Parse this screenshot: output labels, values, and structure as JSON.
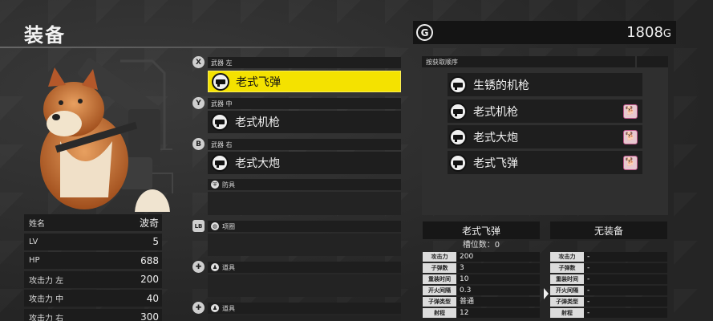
{
  "screen": {
    "title": "装备"
  },
  "gold": {
    "icon": "G",
    "amount": "1808",
    "unit": "G"
  },
  "character": {
    "portrait": "shiba-inu-with-gun",
    "stats": [
      {
        "label": "姓名",
        "value": "波奇"
      },
      {
        "label": "LV",
        "value": "5"
      },
      {
        "label": "HP",
        "value": "688"
      },
      {
        "label": "攻击力 左",
        "value": "200"
      },
      {
        "label": "攻击力 中",
        "value": "40"
      },
      {
        "label": "攻击力 右",
        "value": "300"
      }
    ]
  },
  "slots": {
    "weapon_left": {
      "button": "X",
      "label": "武器 左",
      "item": "老式飞弹"
    },
    "weapon_mid": {
      "button": "Y",
      "label": "武器 中",
      "item": "老式机枪"
    },
    "weapon_right": {
      "button": "B",
      "label": "武器 右",
      "item": "老式大炮"
    },
    "armor": {
      "label": "防具"
    },
    "collar": {
      "button": "LB",
      "label": "项圈"
    },
    "item1": {
      "label": "道具"
    },
    "item2": {
      "label": "道具"
    }
  },
  "acquisition": {
    "header": "按获取顺序",
    "items": [
      {
        "name": "生锈的机枪",
        "equipped_by": ""
      },
      {
        "name": "老式机枪",
        "equipped_by": "dog-icon"
      },
      {
        "name": "老式大炮",
        "equipped_by": "dog-icon"
      },
      {
        "name": "老式飞弹",
        "equipped_by": "dog-icon"
      }
    ]
  },
  "compare": {
    "left": {
      "title": "老式飞弹",
      "subtitle": "槽位数：0",
      "rows": [
        {
          "label": "攻击力",
          "value": "200"
        },
        {
          "label": "子弹数",
          "value": "3"
        },
        {
          "label": "重装时间",
          "value": "10"
        },
        {
          "label": "开火间隔",
          "value": "0.3"
        },
        {
          "label": "子弹类型",
          "value": "普通"
        },
        {
          "label": "射程",
          "value": "12"
        }
      ]
    },
    "right": {
      "title": "无装备",
      "rows": [
        {
          "label": "攻击力",
          "value": "-"
        },
        {
          "label": "子弹数",
          "value": "-"
        },
        {
          "label": "重装时间",
          "value": "-"
        },
        {
          "label": "开火间隔",
          "value": "-"
        },
        {
          "label": "子弹类型",
          "value": "-"
        },
        {
          "label": "射程",
          "value": "-"
        }
      ]
    }
  }
}
